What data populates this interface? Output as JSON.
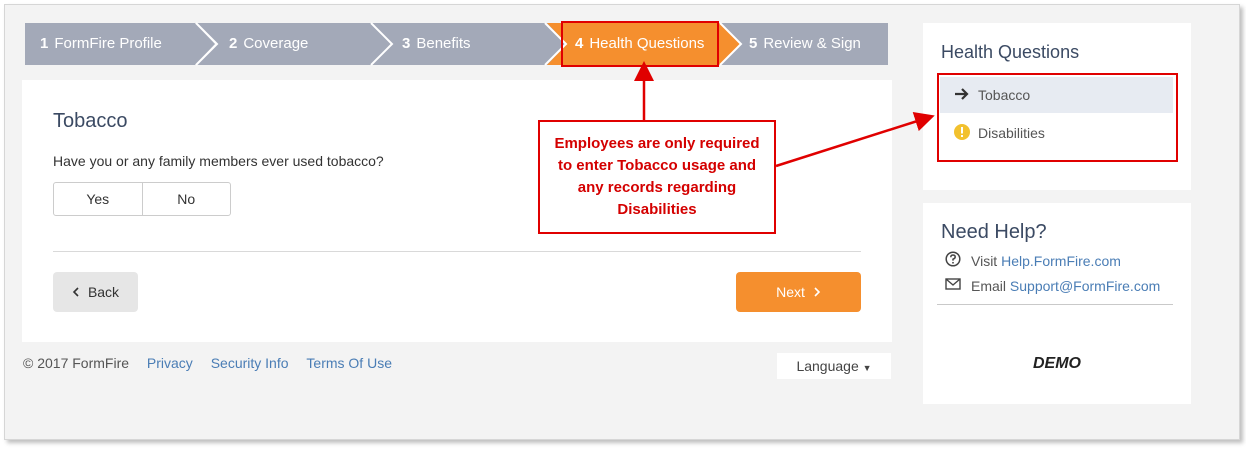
{
  "stepper": {
    "steps": [
      {
        "num": "1",
        "label": "FormFire Profile"
      },
      {
        "num": "2",
        "label": "Coverage"
      },
      {
        "num": "3",
        "label": "Benefits"
      },
      {
        "num": "4",
        "label": "Health Questions"
      },
      {
        "num": "5",
        "label": "Review & Sign"
      }
    ],
    "active_index": 3
  },
  "main": {
    "section_title": "Tobacco",
    "question": "Have you or any family members ever used tobacco?",
    "options": [
      "Yes",
      "No"
    ],
    "back_label": "Back",
    "next_label": "Next"
  },
  "footer": {
    "copyright": "© 2017 FormFire",
    "links": [
      "Privacy",
      "Security Info",
      "Terms Of Use"
    ],
    "language_label": "Language"
  },
  "sidebar": {
    "title": "Health Questions",
    "items": [
      {
        "label": "Tobacco",
        "icon": "arrow-right-icon",
        "selected": true
      },
      {
        "label": "Disabilities",
        "icon": "warning-icon",
        "selected": false
      }
    ],
    "help": {
      "title": "Need Help?",
      "visit_prefix": "Visit",
      "visit_link": "Help.FormFire.com",
      "email_prefix": "Email",
      "email_link": "Support@FormFire.com"
    },
    "demo_label": "DEMO"
  },
  "annotation": {
    "callout_text": "Employees are only required to enter Tobacco usage and any records regarding Disabilities"
  },
  "colors": {
    "accent": "#f58f2e",
    "step_inactive": "#a3a9b8",
    "annotation_red": "#e00000",
    "link": "#4a7db5"
  }
}
